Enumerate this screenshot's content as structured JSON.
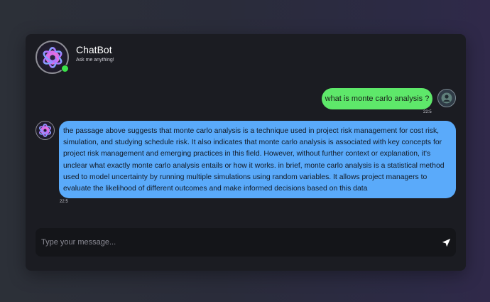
{
  "header": {
    "bot_name": "ChatBot",
    "subtitle": "Ask me anything!",
    "avatar_icon": "openai-logo-icon",
    "status": "online",
    "status_color": "#3be24a"
  },
  "messages": [
    {
      "sender": "user",
      "text": "what is monte carlo analysis ?",
      "time": "22:5",
      "bubble_color": "#5ee86a",
      "avatar_icon": "user-icon"
    },
    {
      "sender": "bot",
      "text": "the passage above suggests that monte carlo analysis is a technique used in project risk management for cost risk, simulation, and studying schedule risk. It also indicates that monte carlo analysis is associated with key concepts for project risk management and emerging practices in this field. However, without further context or explanation, it's unclear what exactly monte carlo analysis entails or how it works. in brief, monte carlo analysis is a statistical method used to model uncertainty by running multiple simulations using random variables. It allows project managers to evaluate the likelihood of different outcomes and make informed decisions based on this data",
      "time": "22:5",
      "bubble_color": "#5aaafa",
      "avatar_icon": "openai-logo-icon"
    }
  ],
  "composer": {
    "placeholder": "Type your message...",
    "value": "",
    "send_icon": "send-icon"
  }
}
